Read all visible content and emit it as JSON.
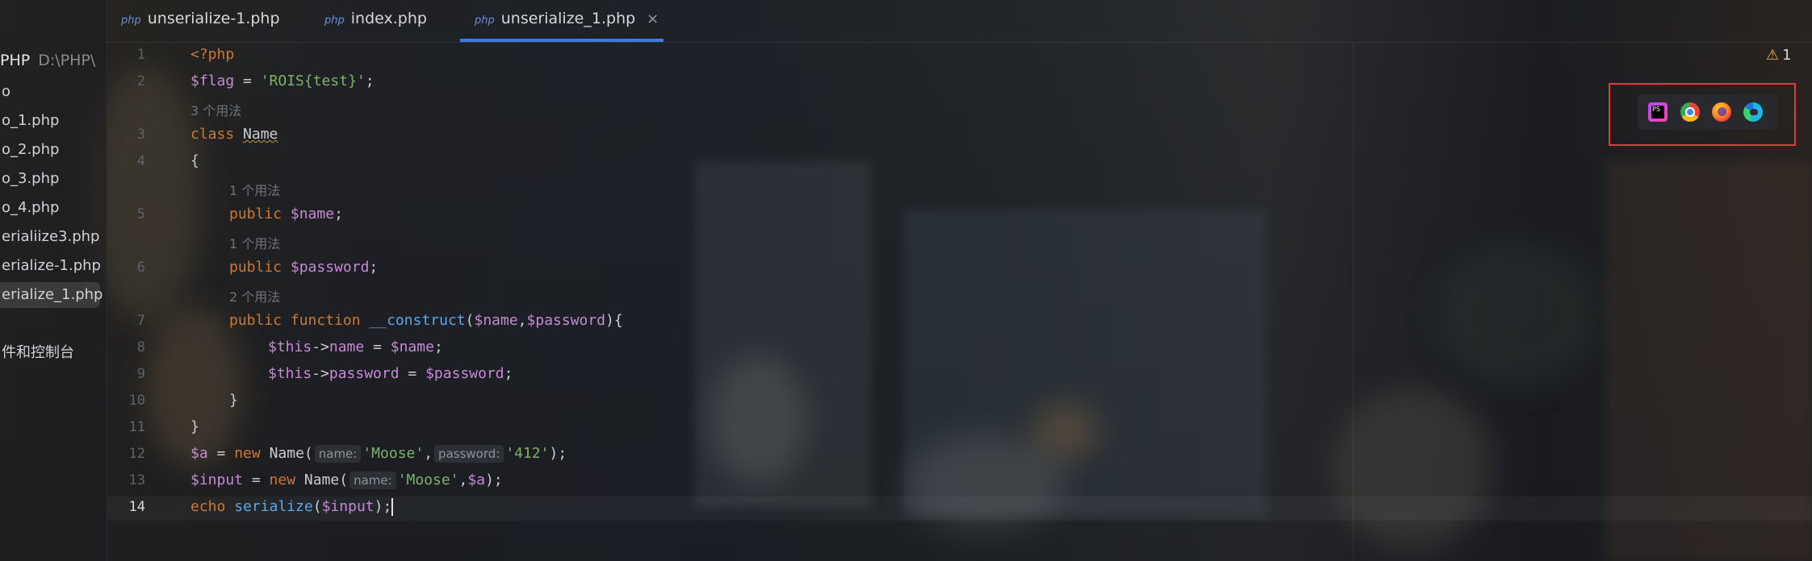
{
  "sidebar": {
    "project_name": "PHP",
    "project_path": "D:\\PHP\\",
    "items": [
      {
        "label": "o"
      },
      {
        "label": "o_1.php"
      },
      {
        "label": "o_2.php"
      },
      {
        "label": "o_3.php"
      },
      {
        "label": "o_4.php"
      },
      {
        "label": "erialiize3.php"
      },
      {
        "label": "erialize-1.php"
      },
      {
        "label": "erialize_1.php"
      }
    ],
    "footer": "件和控制台"
  },
  "tabs": [
    {
      "icon_text": "php",
      "label": "unserialize-1.php"
    },
    {
      "icon_text": "php",
      "label": "index.php"
    },
    {
      "icon_text": "php",
      "label": "unserialize_1.php",
      "close": "×"
    }
  ],
  "line_numbers": [
    "1",
    "2",
    "3",
    "4",
    "5",
    "6",
    "7",
    "8",
    "9",
    "10",
    "11",
    "12",
    "13",
    "14"
  ],
  "usage_hints": {
    "class": "3 个用法",
    "name": "1 个用法",
    "password": "1 个用法",
    "construct": "2 个用法"
  },
  "code": {
    "l1": "<?php",
    "l2_var": "$flag",
    "l2_eq": " = ",
    "l2_str": "'ROIS{test}'",
    "l2_end": ";",
    "l3_kw": "class",
    "l3_name": "Name",
    "l4": "{",
    "public": "public",
    "l5_var": "$name",
    "semi": ";",
    "l6_var": "$password",
    "l7_fn_kw": "function",
    "l7_fn": "__construct",
    "l7_open": "(",
    "l7_p1": "$name",
    "l7_comma": ",",
    "l7_p2": "$password",
    "l7_close": "){",
    "this": "$this",
    "arrow": "->",
    "l8_prop": "name",
    "assign": " = ",
    "l8_val": "$name",
    "l9_prop": "password",
    "l9_val": "$password",
    "l10": "}",
    "l11": "}",
    "l12_var": "$a",
    "new": "new",
    "name_call": "Name(",
    "hint_name": "name:",
    "str_moose": "'Moose'",
    "hint_password": "password:",
    "str_412": "'412'",
    "close_semi": ");",
    "l13_var": "$input",
    "l13_a": "$a",
    "l14_kw": "echo",
    "l14_fn": "serialize",
    "l14_open": "(",
    "l14_arg": "$input",
    "l14_close": ");"
  },
  "inspection": {
    "warning_count": "1"
  },
  "browsers": [
    {
      "name": "phpstorm-icon",
      "color": "#b34dff"
    },
    {
      "name": "chrome-icon",
      "color": "#e8a33a"
    },
    {
      "name": "firefox-icon",
      "color": "#ff6a3d"
    },
    {
      "name": "edge-icon",
      "color": "#2ba3e0"
    }
  ]
}
